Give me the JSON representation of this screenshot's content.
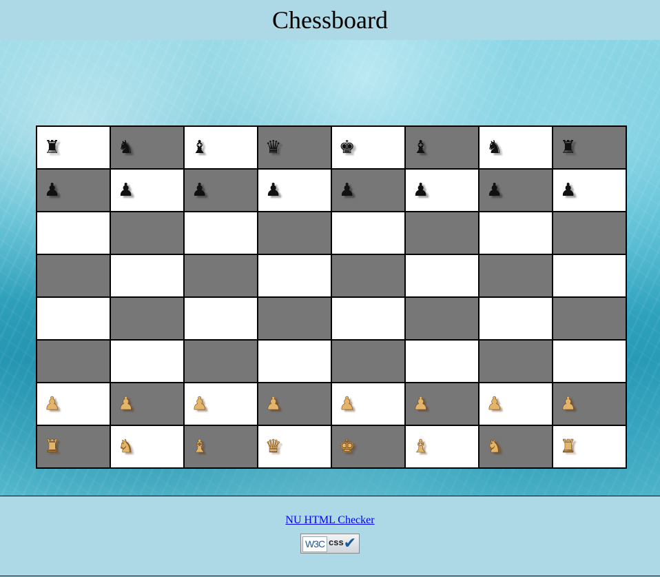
{
  "header": {
    "title": "Chessboard"
  },
  "board": {
    "colors": {
      "light": "#ffffff",
      "dark": "#777777",
      "black_piece": "#111111",
      "white_piece": "#e3b56a"
    },
    "rows": [
      [
        "black-rook",
        "black-knight",
        "black-bishop",
        "black-queen",
        "black-king",
        "black-bishop",
        "black-knight",
        "black-rook"
      ],
      [
        "black-pawn",
        "black-pawn",
        "black-pawn",
        "black-pawn",
        "black-pawn",
        "black-pawn",
        "black-pawn",
        "black-pawn"
      ],
      [
        "",
        "",
        "",
        "",
        "",
        "",
        "",
        ""
      ],
      [
        "",
        "",
        "",
        "",
        "",
        "",
        "",
        ""
      ],
      [
        "",
        "",
        "",
        "",
        "",
        "",
        "",
        ""
      ],
      [
        "",
        "",
        "",
        "",
        "",
        "",
        "",
        ""
      ],
      [
        "white-pawn",
        "white-pawn",
        "white-pawn",
        "white-pawn",
        "white-pawn",
        "white-pawn",
        "white-pawn",
        "white-pawn"
      ],
      [
        "white-rook",
        "white-knight",
        "white-bishop",
        "white-queen",
        "white-king",
        "white-bishop",
        "white-knight",
        "white-rook"
      ]
    ]
  },
  "footer": {
    "checker_link": "NU HTML Checker",
    "badge_icon": "w3c-css-valid-badge-icon"
  }
}
